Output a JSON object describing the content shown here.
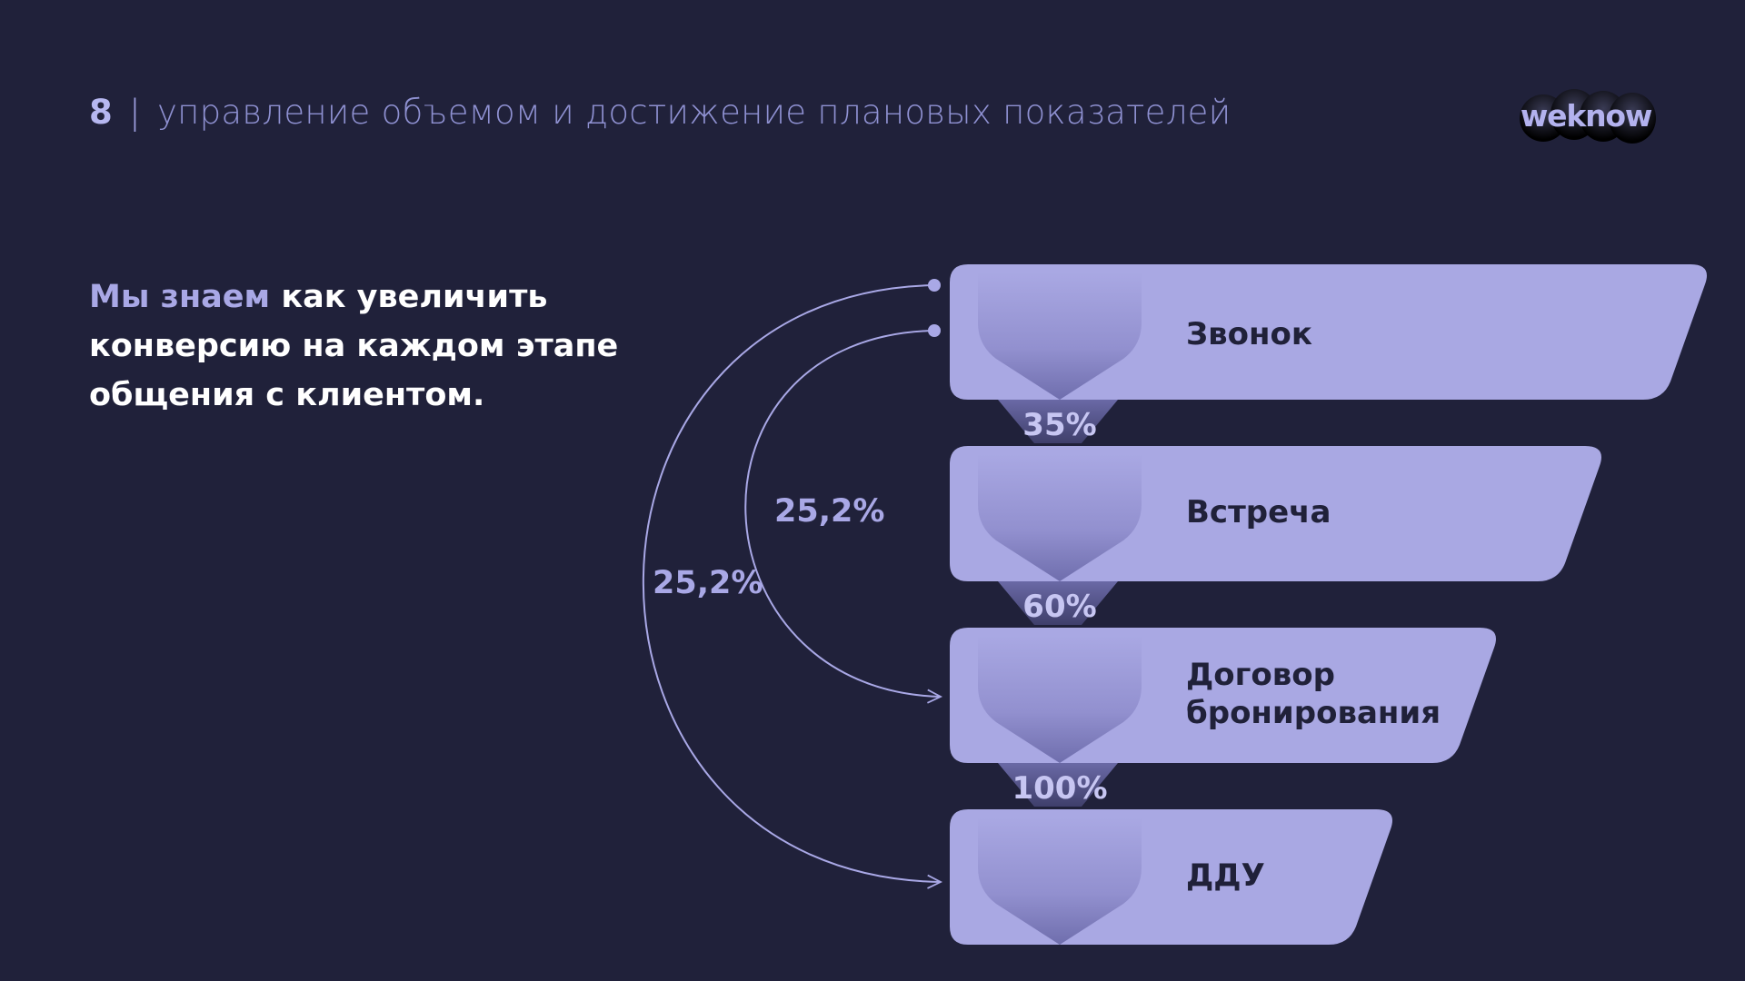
{
  "header": {
    "number": "8",
    "separator": "|",
    "title": "управление объемом и достижение плановых показателей"
  },
  "logo": {
    "text": "weknow"
  },
  "intro": {
    "accent": "Мы знаем",
    "rest": " как увеличить конверсию на каждом этапе общения с клиентом."
  },
  "funnel": {
    "stages": [
      {
        "line1": "Звонок",
        "line2": ""
      },
      {
        "line1": "Встреча",
        "line2": ""
      },
      {
        "line1": "Договор",
        "line2": "бронирования"
      },
      {
        "line1": "ДДУ",
        "line2": ""
      }
    ],
    "conversions": [
      "35%",
      "60%",
      "100%"
    ],
    "arcs": [
      {
        "label": "25,2%",
        "from": "Звонок",
        "to": "Договор бронирования"
      },
      {
        "label": "25,2%",
        "from": "Звонок",
        "to": "ДДУ"
      }
    ]
  },
  "colors": {
    "background": "#20213a",
    "stage_fill": "#a9a8e3",
    "text_light": "#ffffff",
    "accent": "#a9a8e6",
    "dark_text": "#202139"
  }
}
